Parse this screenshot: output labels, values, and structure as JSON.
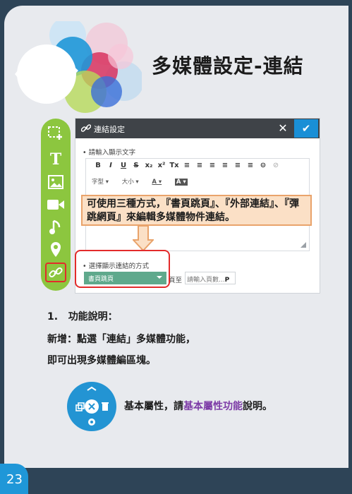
{
  "page_title": "多媒體設定-連結",
  "page_number": "23",
  "toolbar": {
    "icons": [
      "select-add-icon",
      "text-icon",
      "image-icon",
      "video-icon",
      "music-icon",
      "location-icon",
      "link-icon"
    ],
    "text_glyph": "T"
  },
  "dialog": {
    "title": "連結設定",
    "close_glyph": "✕",
    "ok_glyph": "✔",
    "display_text_label": "• 請輸入顯示文字",
    "editor_buttons": [
      "B",
      "I",
      "U",
      "S",
      "x₂",
      "x²",
      "Tx",
      "≡",
      "≡",
      "≡",
      "≡",
      "≡",
      "≡",
      "⊝",
      "⊘"
    ],
    "font_select": "字型",
    "size_select": "大小",
    "method_label": "• 選擇顯示連結的方式",
    "method_value": "書頁跳頁",
    "page_prefix": "頁至",
    "page_placeholder": "請輸入頁數...",
    "page_suffix": "P"
  },
  "callout": {
    "text": "可使用三種方式，『書頁跳頁』、『外部連結』、『彈跳網頁』來編輯多媒體物件連結。"
  },
  "section": {
    "heading_num": "1.",
    "heading": "功能說明：",
    "line1": "新增：點選「連結」多媒體功能，",
    "line2": "即可出現多媒體編區塊。",
    "note_prefix": "基本屬性，請",
    "note_link": "基本屬性功能",
    "note_suffix": "說明。"
  },
  "colors": {
    "background": "#2e4457",
    "card": "#e8eaee",
    "accent_green": "#8cc63f",
    "accent_blue": "#1a8fd6",
    "highlight_red": "#e32b2b",
    "callout_fill": "#fbe0c6",
    "link_purple": "#7c3aa6"
  }
}
